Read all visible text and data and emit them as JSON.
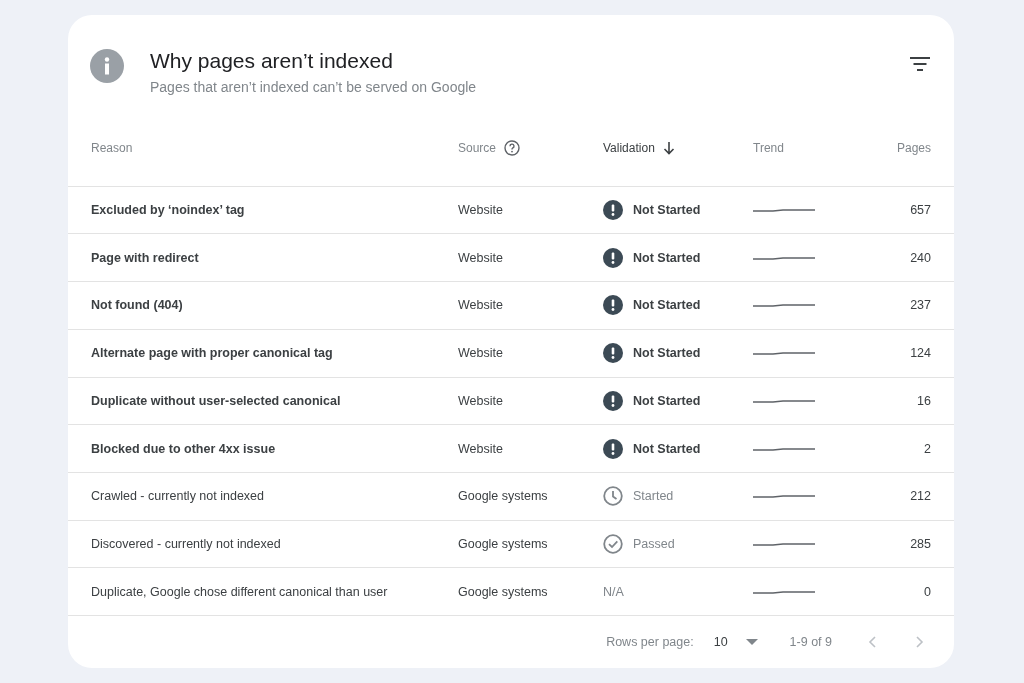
{
  "card": {
    "title": "Why pages aren’t indexed",
    "subtitle": "Pages that aren’t indexed can’t be served on Google"
  },
  "table": {
    "columns": [
      {
        "label": "Reason",
        "kind": "plain"
      },
      {
        "label": "Source",
        "kind": "help"
      },
      {
        "label": "Validation",
        "kind": "sorted"
      },
      {
        "label": "Trend",
        "kind": "plain"
      },
      {
        "label": "Pages",
        "kind": "plain"
      }
    ],
    "rows": [
      {
        "reason": "Excluded by ‘noindex’ tag",
        "bold": true,
        "source": "Website",
        "validation": {
          "kind": "not_started",
          "label": "Not Started"
        },
        "pages": "657"
      },
      {
        "reason": "Page with redirect",
        "bold": true,
        "source": "Website",
        "validation": {
          "kind": "not_started",
          "label": "Not Started"
        },
        "pages": "240"
      },
      {
        "reason": "Not found (404)",
        "bold": true,
        "source": "Website",
        "validation": {
          "kind": "not_started",
          "label": "Not Started"
        },
        "pages": "237"
      },
      {
        "reason": "Alternate page with proper canonical tag",
        "bold": true,
        "source": "Website",
        "validation": {
          "kind": "not_started",
          "label": "Not Started"
        },
        "pages": "124"
      },
      {
        "reason": "Duplicate without user-selected canonical",
        "bold": true,
        "source": "Website",
        "validation": {
          "kind": "not_started",
          "label": "Not Started"
        },
        "pages": "16"
      },
      {
        "reason": "Blocked due to other 4xx issue",
        "bold": true,
        "source": "Website",
        "validation": {
          "kind": "not_started",
          "label": "Not Started"
        },
        "pages": "2"
      },
      {
        "reason": "Crawled - currently not indexed",
        "bold": false,
        "source": "Google systems",
        "validation": {
          "kind": "started",
          "label": "Started"
        },
        "pages": "212"
      },
      {
        "reason": "Discovered - currently not indexed",
        "bold": false,
        "source": "Google systems",
        "validation": {
          "kind": "passed",
          "label": "Passed"
        },
        "pages": "285"
      },
      {
        "reason": "Duplicate, Google chose different canonical than user",
        "bold": false,
        "source": "Google systems",
        "validation": {
          "kind": "none",
          "label": "N/A"
        },
        "pages": "0"
      }
    ]
  },
  "pagination": {
    "rows_label": "Rows per page:",
    "rows_value": "10",
    "range": "1-9 of 9"
  }
}
